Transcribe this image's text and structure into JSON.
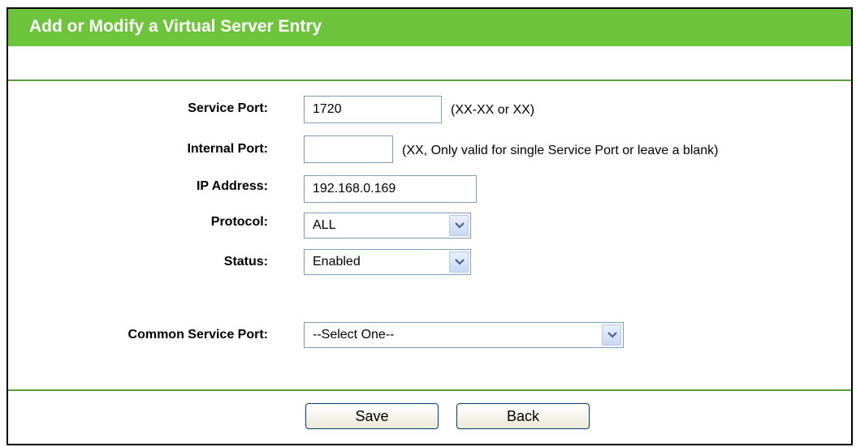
{
  "header": {
    "title": "Add or Modify a Virtual Server Entry"
  },
  "form": {
    "service_port": {
      "label": "Service Port:",
      "value": "1720",
      "hint": "(XX-XX or XX)"
    },
    "internal_port": {
      "label": "Internal Port:",
      "value": "",
      "hint": "(XX, Only valid for single Service Port or leave a blank)"
    },
    "ip_address": {
      "label": "IP Address:",
      "value": "192.168.0.169"
    },
    "protocol": {
      "label": "Protocol:",
      "selected": "ALL"
    },
    "status": {
      "label": "Status:",
      "selected": "Enabled"
    },
    "common_service_port": {
      "label": "Common Service Port:",
      "selected": "--Select One--"
    }
  },
  "buttons": {
    "save_label": "Save",
    "back_label": "Back"
  },
  "colors": {
    "header_bg": "#6ec43b",
    "divider": "#5a9e3a"
  },
  "icons": {
    "dropdown": "chevron-down-icon"
  }
}
